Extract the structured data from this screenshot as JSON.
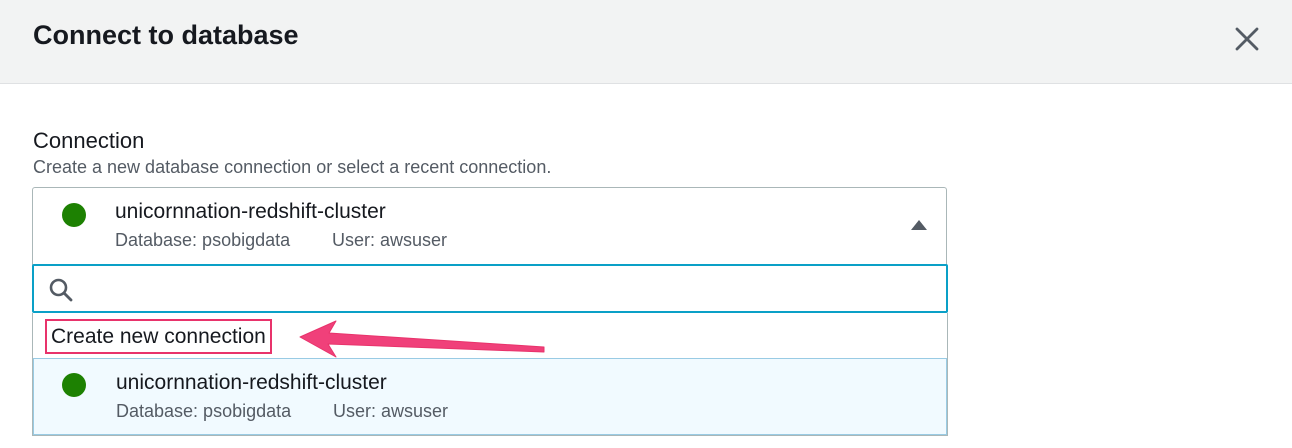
{
  "modal": {
    "title": "Connect to database",
    "close_icon": "close-icon"
  },
  "connection": {
    "label": "Connection",
    "description": "Create a new database connection or select a recent connection.",
    "selected": {
      "name": "unicornnation-redshift-cluster",
      "database": "Database: psobigdata",
      "user": "User: awsuser",
      "status_color": "#1d8102"
    },
    "search": {
      "placeholder": "",
      "value": ""
    },
    "options": {
      "create_label": "Create new connection",
      "items": [
        {
          "name": "unicornnation-redshift-cluster",
          "database": "Database: psobigdata",
          "user": "User: awsuser"
        }
      ]
    }
  },
  "annotation": {
    "highlight_color": "#e8336b",
    "arrow_color": "#f0407a"
  }
}
